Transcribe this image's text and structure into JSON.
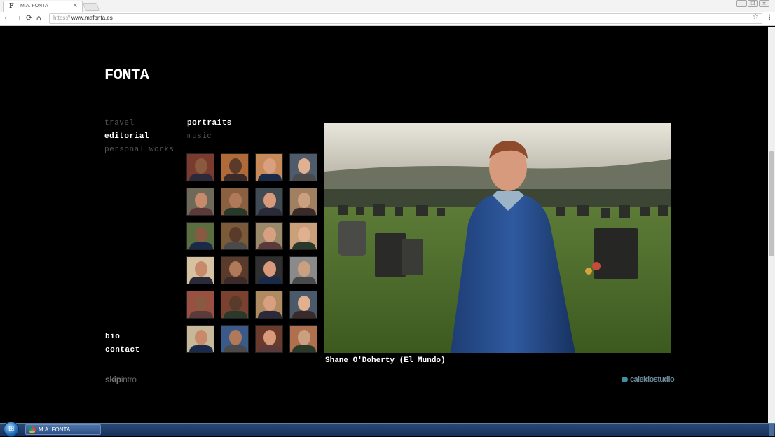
{
  "browser": {
    "tab_title": "M.A. FONTA",
    "tab_favicon": "F",
    "tab_close": "×",
    "url_scheme": "https://",
    "url_host": "www.mafonta.es",
    "back_icon": "←",
    "forward_icon": "→",
    "reload_icon": "⟳",
    "home_icon": "⌂",
    "star_icon": "☆",
    "menu_icon": "⋮"
  },
  "site": {
    "logo": "FONTA",
    "categories_left": [
      {
        "label": "travel",
        "active": false
      },
      {
        "label": "editorial",
        "active": true
      },
      {
        "label": "personal works",
        "active": false
      }
    ],
    "categories_right": [
      {
        "label": "portraits",
        "active": true
      },
      {
        "label": "music",
        "active": false
      }
    ],
    "bottom_links": [
      {
        "label": "bio"
      },
      {
        "label": "contact"
      }
    ],
    "skip_intro": {
      "bold": "skip",
      "thin": "intro"
    },
    "studio_credit": "caleidostudio",
    "caption": "Shane O'Doherty (El Mundo)",
    "thumbnail_count": 24
  },
  "taskbar": {
    "start_icon": "⊞",
    "task_label": "M.A. FONTA"
  },
  "colors": {
    "background": "#000000",
    "active_text": "#ffffff",
    "inactive_text": "#555555",
    "studio_accent": "#3f8fa8"
  }
}
